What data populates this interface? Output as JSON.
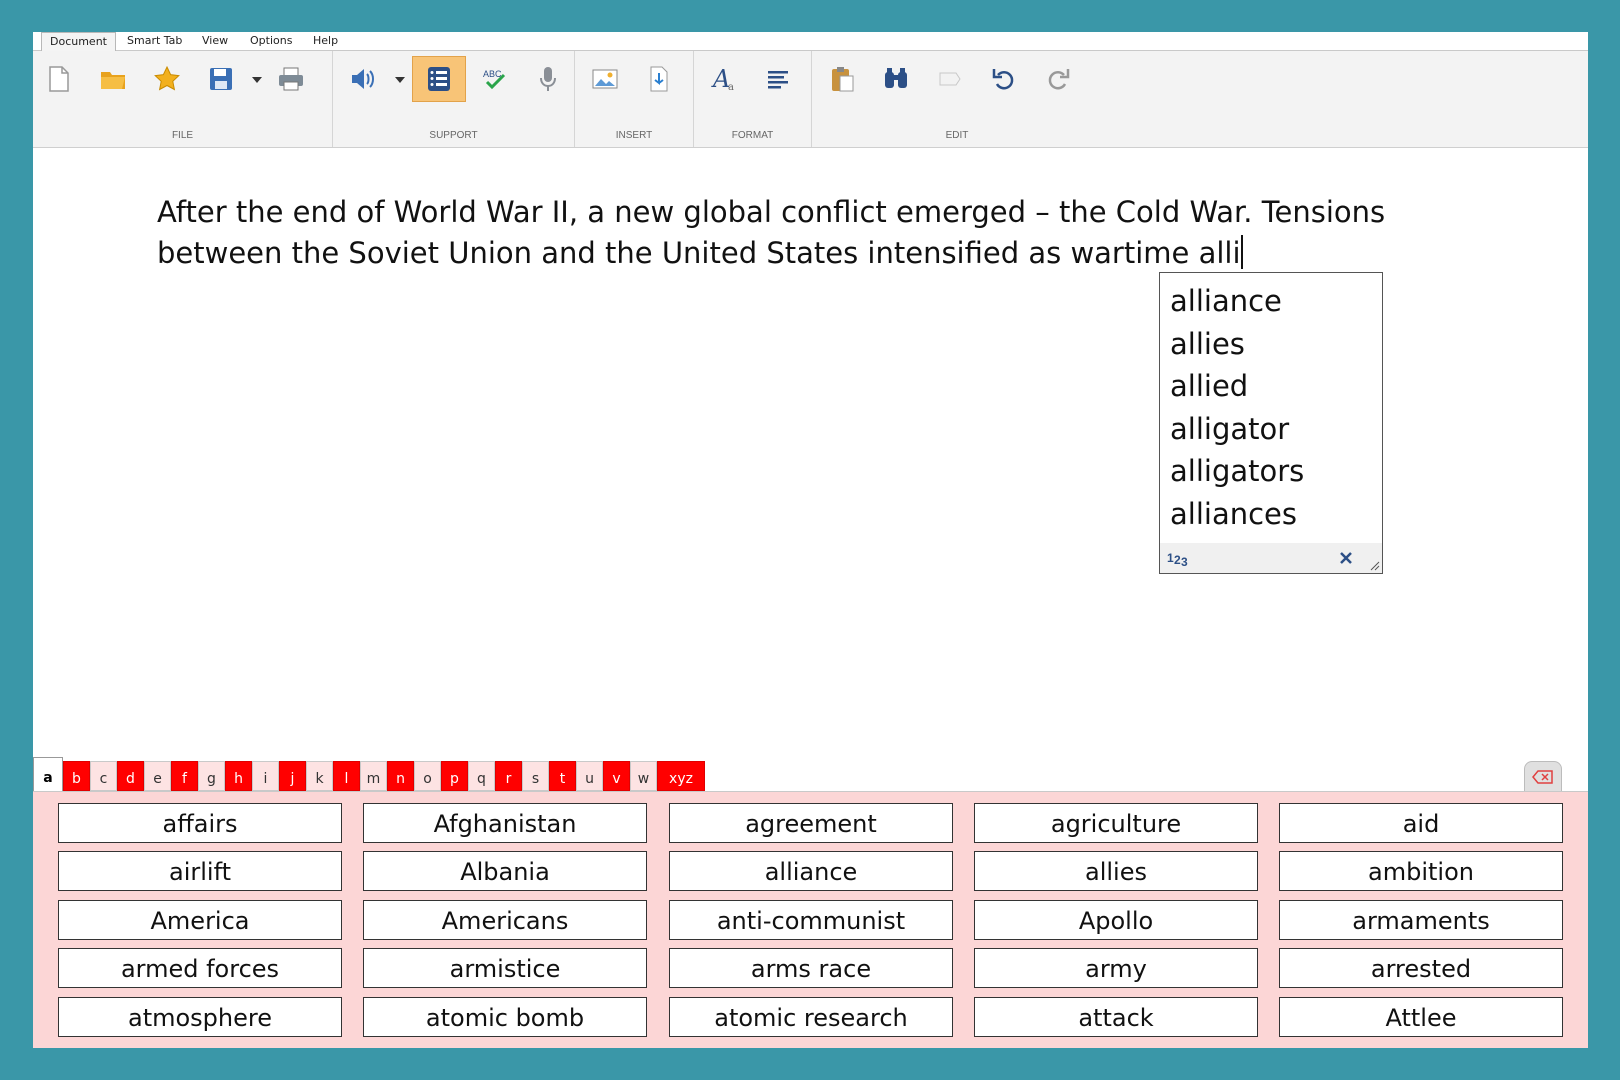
{
  "menu": [
    "Document",
    "Smart Tab",
    "View",
    "Options",
    "Help"
  ],
  "ribbon": {
    "groups": [
      {
        "label": "FILE"
      },
      {
        "label": "SUPPORT"
      },
      {
        "label": "INSERT"
      },
      {
        "label": "FORMAT"
      },
      {
        "label": "EDIT"
      }
    ]
  },
  "icons": [
    "new-document-icon",
    "open-folder-icon",
    "favorite-star-icon",
    "save-icon",
    "dropdown-arrow-icon",
    "print-icon",
    "speaker-icon",
    "dropdown-arrow-icon",
    "word-prediction-icon",
    "spellcheck-icon",
    "microphone-icon",
    "insert-picture-icon",
    "insert-audio-icon",
    "font-icon",
    "paragraph-align-icon",
    "paste-icon",
    "find-binoculars-icon",
    "eraser-icon",
    "undo-icon",
    "redo-icon"
  ],
  "document": {
    "line1": "After the end of World War II, a new global conflict emerged – the Cold War. Tensions",
    "line2": "between the Soviet Union and the United States intensified as wartime alli"
  },
  "prediction": {
    "items": [
      "alliance",
      "allies",
      "allied",
      "alligator",
      "alligators",
      "alliances"
    ]
  },
  "letters": [
    "a",
    "b",
    "c",
    "d",
    "e",
    "f",
    "g",
    "h",
    "i",
    "j",
    "k",
    "l",
    "m",
    "n",
    "o",
    "p",
    "q",
    "r",
    "s",
    "t",
    "u",
    "v",
    "w",
    "xyz"
  ],
  "red_letters": [
    "b",
    "d",
    "f",
    "h",
    "j",
    "l",
    "n",
    "p",
    "r",
    "t",
    "v",
    "xyz"
  ],
  "selected_letter": "a",
  "colors": {
    "accent_red": "#ff0000",
    "wordbank_bg": "#fcd6d6",
    "frame": "#3a97a8",
    "support_active": "#f8c477"
  },
  "words": [
    [
      "affairs",
      "Afghanistan",
      "agreement",
      "agriculture",
      "aid"
    ],
    [
      "airlift",
      "Albania",
      "alliance",
      "allies",
      "ambition"
    ],
    [
      "America",
      "Americans",
      "anti-communist",
      "Apollo",
      "armaments"
    ],
    [
      "armed forces",
      "armistice",
      "arms race",
      "army",
      "arrested"
    ],
    [
      "atmosphere",
      "atomic bomb",
      "atomic research",
      "attack",
      "Attlee"
    ]
  ]
}
